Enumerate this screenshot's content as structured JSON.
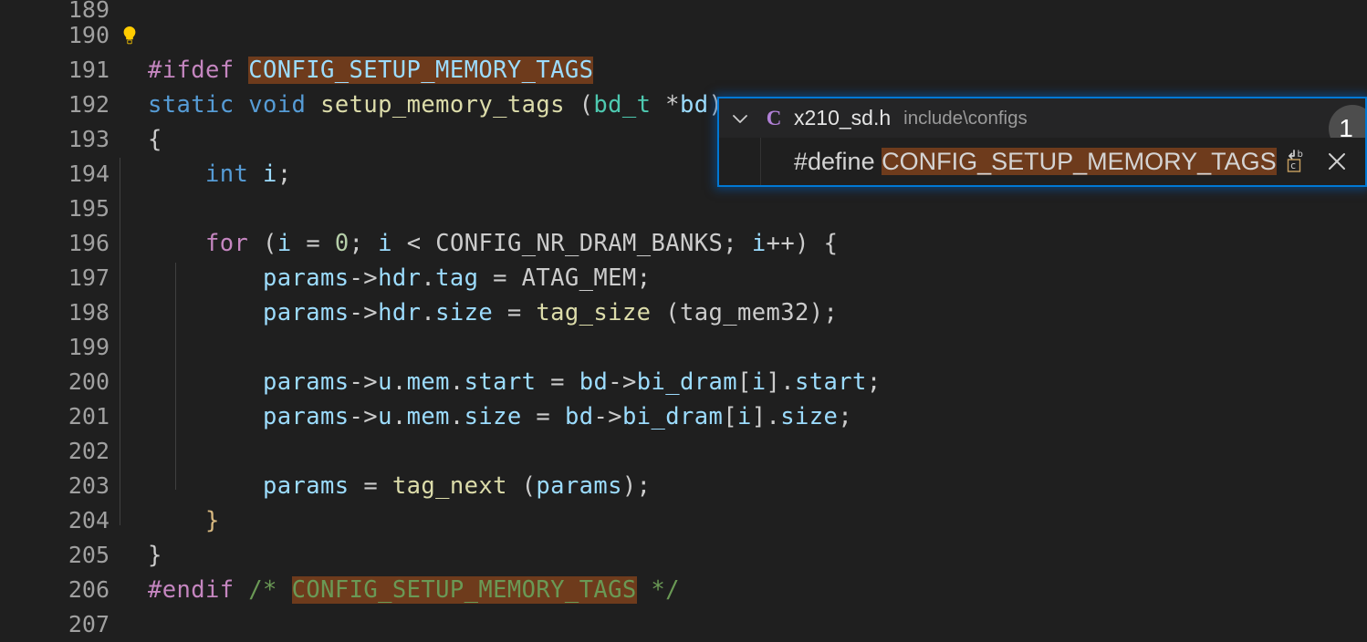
{
  "editor": {
    "background": "#1f1f1f",
    "line_number_color": "#a0a0a0",
    "highlight_color": "#6e3b1c",
    "first_line": 189,
    "lines": [
      {
        "number": "189",
        "text": ""
      },
      {
        "number": "190",
        "text": "",
        "icon": "lightbulb-icon"
      },
      {
        "number": "191",
        "text": "#ifdef CONFIG_SETUP_MEMORY_TAGS"
      },
      {
        "number": "192",
        "text": "static void setup_memory_tags (bd_t *bd)"
      },
      {
        "number": "193",
        "text": "{"
      },
      {
        "number": "194",
        "text": "    int i;"
      },
      {
        "number": "195",
        "text": ""
      },
      {
        "number": "196",
        "text": "    for (i = 0; i < CONFIG_NR_DRAM_BANKS; i++) {"
      },
      {
        "number": "197",
        "text": "        params->hdr.tag = ATAG_MEM;"
      },
      {
        "number": "198",
        "text": "        params->hdr.size = tag_size (tag_mem32);"
      },
      {
        "number": "199",
        "text": ""
      },
      {
        "number": "200",
        "text": "        params->u.mem.start = bd->bi_dram[i].start;"
      },
      {
        "number": "201",
        "text": "        params->u.mem.size = bd->bi_dram[i].size;"
      },
      {
        "number": "202",
        "text": ""
      },
      {
        "number": "203",
        "text": "        params = tag_next (params);"
      },
      {
        "number": "204",
        "text": "    }"
      },
      {
        "number": "205",
        "text": "}"
      },
      {
        "number": "206",
        "text": "#endif /* CONFIG_SETUP_MEMORY_TAGS */"
      },
      {
        "number": "207",
        "text": ""
      }
    ]
  },
  "peek": {
    "chevron": "⌄",
    "file_icon_letter": "C",
    "file_name": "x210_sd.h",
    "file_path": "include\\configs",
    "result_count": "1",
    "preview_prefix": "#define ",
    "preview_symbol": "CONFIG_SETUP_MEMORY_TAGS",
    "actions": {
      "definition_label": "go-to-definition",
      "close_label": "✕"
    },
    "border_color": "#0078d4"
  }
}
